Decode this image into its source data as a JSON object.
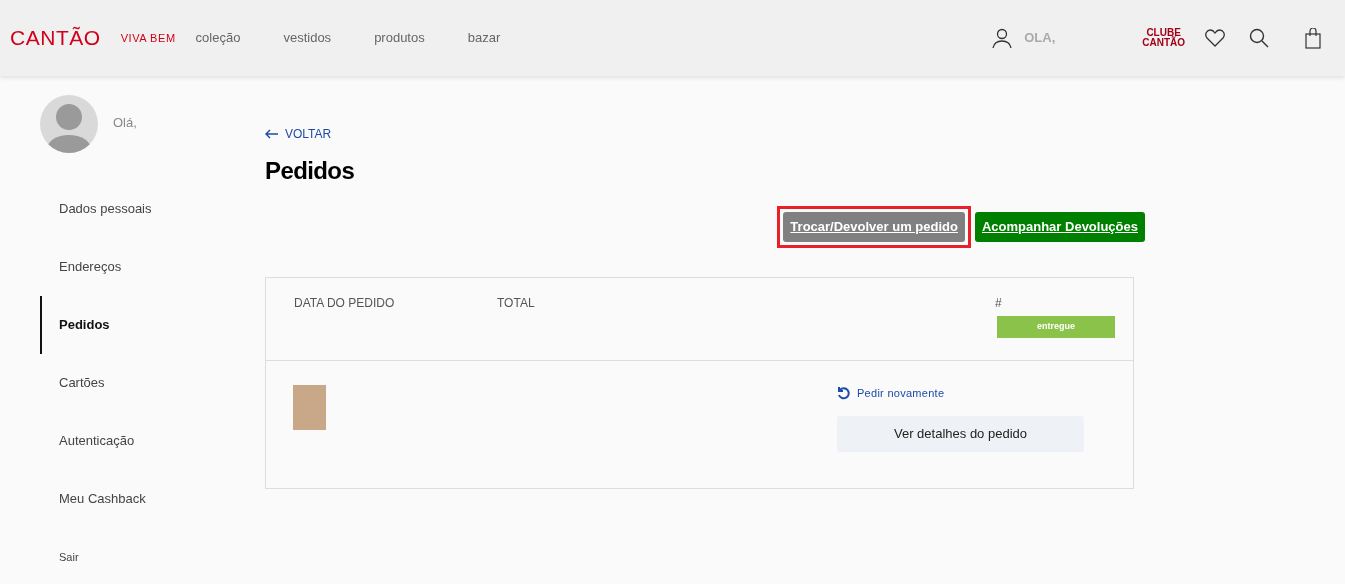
{
  "header": {
    "logo": "CANTÃO",
    "tagline": "VIVA BEM",
    "nav": [
      "coleção",
      "vestidos",
      "produtos",
      "bazar"
    ],
    "greeting": "OLA,",
    "club": [
      "CLUBE",
      "CANTÃO"
    ]
  },
  "sidebar": {
    "greeting": "Olá,",
    "items": [
      {
        "label": "Dados pessoais",
        "selected": false
      },
      {
        "label": "Endereços",
        "selected": false
      },
      {
        "label": "Pedidos",
        "selected": true
      },
      {
        "label": "Cartões",
        "selected": false
      },
      {
        "label": "Autenticação",
        "selected": false
      },
      {
        "label": "Meu Cashback",
        "selected": false
      },
      {
        "label": "Sair",
        "selected": false
      }
    ]
  },
  "back_link": "VOLTAR",
  "title": "Pedidos",
  "actions": [
    {
      "label": "Trocar/Devolver um pedido",
      "kind": "gray",
      "highlighted": true
    },
    {
      "label": "Acompanhar Devoluções",
      "kind": "green",
      "highlighted": false
    }
  ],
  "order": {
    "columns": [
      "DATA DO PEDIDO",
      "TOTAL"
    ],
    "number": "#",
    "status": "entregue",
    "reorder": "Pedir novamente",
    "details": "Ver detalhes do pedido"
  }
}
